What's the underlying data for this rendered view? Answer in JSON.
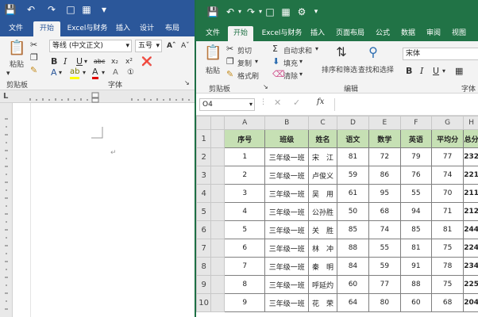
{
  "word": {
    "tabs": [
      {
        "label": "文件",
        "active": false
      },
      {
        "label": "开始",
        "active": true
      },
      {
        "label": "Excel与财务",
        "active": false
      },
      {
        "label": "插入",
        "active": false
      },
      {
        "label": "设计",
        "active": false
      },
      {
        "label": "布局",
        "active": false
      }
    ],
    "font_name": "等线 (中文正文)",
    "font_size": "五号",
    "paste_label": "粘贴",
    "clipboard_label": "剪贴板",
    "font_group_label": "字体",
    "ruler_marker": "L",
    "colors": {
      "brand": "#2b579a"
    }
  },
  "excel": {
    "colors": {
      "brand": "#217346",
      "header_fill": "#c6e0b4"
    },
    "tabs": [
      {
        "label": "文件",
        "active": false
      },
      {
        "label": "开始",
        "active": true
      },
      {
        "label": "Excel与财务",
        "active": false
      },
      {
        "label": "插入",
        "active": false
      },
      {
        "label": "页面布局",
        "active": false
      },
      {
        "label": "公式",
        "active": false
      },
      {
        "label": "数据",
        "active": false
      },
      {
        "label": "审阅",
        "active": false
      },
      {
        "label": "视图",
        "active": false
      }
    ],
    "ribbon": {
      "paste": "粘贴",
      "cut": "剪切",
      "copy": "复制",
      "format_painter": "格式刷",
      "autosum": "自动求和",
      "fill": "填充",
      "clear": "清除",
      "sort_filter": "排序和筛选",
      "find_select": "查找和选择",
      "font_name": "宋体",
      "clipboard_label": "剪贴板",
      "edit_label": "编辑",
      "font_label": "字体"
    },
    "name_box": "O4",
    "fx": "fx",
    "columns": [
      "A",
      "B",
      "C",
      "D",
      "E",
      "F",
      "G",
      "H"
    ],
    "header_row": [
      "序号",
      "班级",
      "姓名",
      "语文",
      "数学",
      "英语",
      "平均分",
      "总分"
    ],
    "rows": [
      [
        "1",
        "三年级一班",
        "宋　江",
        "81",
        "72",
        "79",
        "77",
        "232"
      ],
      [
        "2",
        "三年级一班",
        "卢俊义",
        "59",
        "86",
        "76",
        "74",
        "221"
      ],
      [
        "3",
        "三年级一班",
        "吴　用",
        "61",
        "95",
        "55",
        "70",
        "211"
      ],
      [
        "4",
        "三年级一班",
        "公孙胜",
        "50",
        "68",
        "94",
        "71",
        "212"
      ],
      [
        "5",
        "三年级一班",
        "关　胜",
        "85",
        "74",
        "85",
        "81",
        "244"
      ],
      [
        "6",
        "三年级一班",
        "林　冲",
        "88",
        "55",
        "81",
        "75",
        "224"
      ],
      [
        "7",
        "三年级一班",
        "秦　明",
        "84",
        "59",
        "91",
        "78",
        "234"
      ],
      [
        "8",
        "三年级一班",
        "呼延灼",
        "60",
        "77",
        "88",
        "75",
        "225"
      ],
      [
        "9",
        "三年级一班",
        "花　荣",
        "64",
        "80",
        "60",
        "68",
        "204"
      ]
    ],
    "row_numbers": [
      "1",
      "2",
      "3",
      "4",
      "5",
      "6",
      "7",
      "8",
      "9",
      "10"
    ]
  }
}
